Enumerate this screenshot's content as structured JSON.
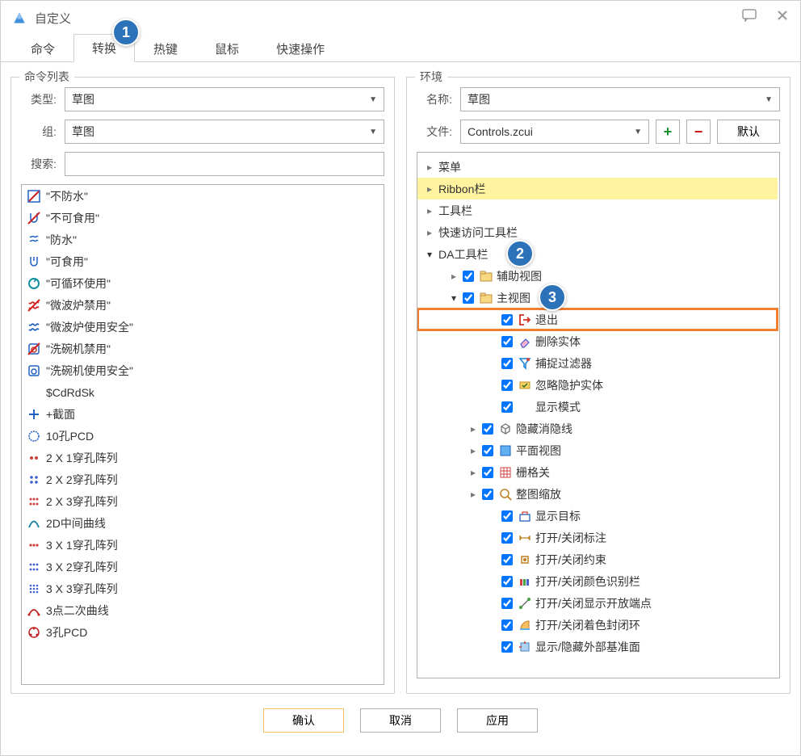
{
  "window": {
    "title": "自定义"
  },
  "annotations": {
    "a1": "1",
    "a2": "2",
    "a3": "3"
  },
  "tabs": [
    {
      "label": "命令"
    },
    {
      "label": "转换",
      "active": true
    },
    {
      "label": "热键"
    },
    {
      "label": "鼠标"
    },
    {
      "label": "快速操作"
    }
  ],
  "leftPanel": {
    "title": "命令列表",
    "typeLabel": "类型:",
    "typeValue": "草图",
    "groupLabel": "组:",
    "groupValue": "草图",
    "searchLabel": "搜索:",
    "items": [
      {
        "label": "\"不防水\"",
        "icon": "no-water-icon",
        "svg": "nowater"
      },
      {
        "label": "\"不可食用\"",
        "icon": "no-food-icon",
        "svg": "nofood"
      },
      {
        "label": "\"防水\"",
        "icon": "water-icon",
        "svg": "water"
      },
      {
        "label": "\"可食用\"",
        "icon": "food-icon",
        "svg": "food"
      },
      {
        "label": "\"可循环使用\"",
        "icon": "recycle-icon",
        "svg": "recycle"
      },
      {
        "label": "\"微波炉禁用\"",
        "icon": "no-microwave-icon",
        "svg": "nomw"
      },
      {
        "label": "\"微波炉使用安全\"",
        "icon": "microwave-safe-icon",
        "svg": "mw"
      },
      {
        "label": "\"洗碗机禁用\"",
        "icon": "no-dishwasher-icon",
        "svg": "nodw"
      },
      {
        "label": "\"洗碗机使用安全\"",
        "icon": "dishwasher-safe-icon",
        "svg": "dw"
      },
      {
        "label": "$CdRdSk",
        "icon": "blank-icon",
        "svg": "blank"
      },
      {
        "label": "+截面",
        "icon": "plus-section-icon",
        "svg": "plus"
      },
      {
        "label": "10孔PCD",
        "icon": "pcd-icon",
        "svg": "gear"
      },
      {
        "label": "2 X 1穿孔阵列",
        "icon": "array-2x1-icon",
        "svg": "grid21"
      },
      {
        "label": "2 X 2穿孔阵列",
        "icon": "array-2x2-icon",
        "svg": "grid22"
      },
      {
        "label": "2 X 3穿孔阵列",
        "icon": "array-2x3-icon",
        "svg": "grid23"
      },
      {
        "label": "2D中间曲线",
        "icon": "2d-curve-icon",
        "svg": "curve"
      },
      {
        "label": "3 X 1穿孔阵列",
        "icon": "array-3x1-icon",
        "svg": "grid31"
      },
      {
        "label": "3 X 2穿孔阵列",
        "icon": "array-3x2-icon",
        "svg": "grid32"
      },
      {
        "label": "3 X 3穿孔阵列",
        "icon": "array-3x3-icon",
        "svg": "grid33"
      },
      {
        "label": "3点二次曲线",
        "icon": "conic-icon",
        "svg": "arc"
      },
      {
        "label": "3孔PCD",
        "icon": "pcd3-icon",
        "svg": "gear3"
      }
    ]
  },
  "rightPanel": {
    "title": "环境",
    "nameLabel": "名称:",
    "nameValue": "草图",
    "fileLabel": "文件:",
    "fileValue": "Controls.zcui",
    "defaultBtn": "默认",
    "tree": [
      {
        "level": 0,
        "chev": "right",
        "label": "菜单"
      },
      {
        "level": 0,
        "chev": "right",
        "label": "Ribbon栏",
        "selected": true
      },
      {
        "level": 0,
        "chev": "right",
        "label": "工具栏"
      },
      {
        "level": 0,
        "chev": "right",
        "label": "快速访问工具栏"
      },
      {
        "level": 0,
        "chev": "down",
        "label": "DA工具栏",
        "ann": "a2"
      },
      {
        "level": 1,
        "chev": "right",
        "check": true,
        "label": "辅助视图",
        "svg": "folder"
      },
      {
        "level": 1,
        "chev": "down",
        "check": true,
        "label": "主视图",
        "svg": "folder",
        "ann": "a3"
      },
      {
        "level": 2,
        "check": true,
        "label": "退出",
        "svg": "exit",
        "hl": true
      },
      {
        "level": 2,
        "check": true,
        "label": "删除实体",
        "svg": "eraser"
      },
      {
        "level": 2,
        "check": true,
        "label": "捕捉过滤器",
        "svg": "filter"
      },
      {
        "level": 2,
        "check": true,
        "label": "忽略隐护实体",
        "svg": "ignore"
      },
      {
        "level": 2,
        "check": true,
        "label": "显示模式",
        "svg": "blank2"
      },
      {
        "level": 2,
        "chev": "right",
        "check": true,
        "label": "隐藏消隐线",
        "svg": "cube",
        "lv3": true
      },
      {
        "level": 2,
        "chev": "right",
        "check": true,
        "label": "平面视图",
        "svg": "planar",
        "lv3": true
      },
      {
        "level": 2,
        "chev": "right",
        "check": true,
        "label": "栅格关",
        "svg": "gridicon",
        "lv3": true
      },
      {
        "level": 2,
        "chev": "right",
        "check": true,
        "label": "整图缩放",
        "svg": "zoom",
        "lv3": true
      },
      {
        "level": 2,
        "check": true,
        "label": "显示目标",
        "svg": "target"
      },
      {
        "level": 2,
        "check": true,
        "label": "打开/关闭标注",
        "svg": "dim"
      },
      {
        "level": 2,
        "check": true,
        "label": "打开/关闭约束",
        "svg": "constraint"
      },
      {
        "level": 2,
        "check": true,
        "label": "打开/关闭颜色识别栏",
        "svg": "colors"
      },
      {
        "level": 2,
        "check": true,
        "label": "打开/关闭显示开放端点",
        "svg": "endpoint"
      },
      {
        "level": 2,
        "check": true,
        "label": "打开/关闭着色封闭环",
        "svg": "shade"
      },
      {
        "level": 2,
        "check": true,
        "label": "显示/隐藏外部基准面",
        "svg": "datum"
      }
    ]
  },
  "footer": {
    "ok": "确认",
    "cancel": "取消",
    "apply": "应用"
  }
}
